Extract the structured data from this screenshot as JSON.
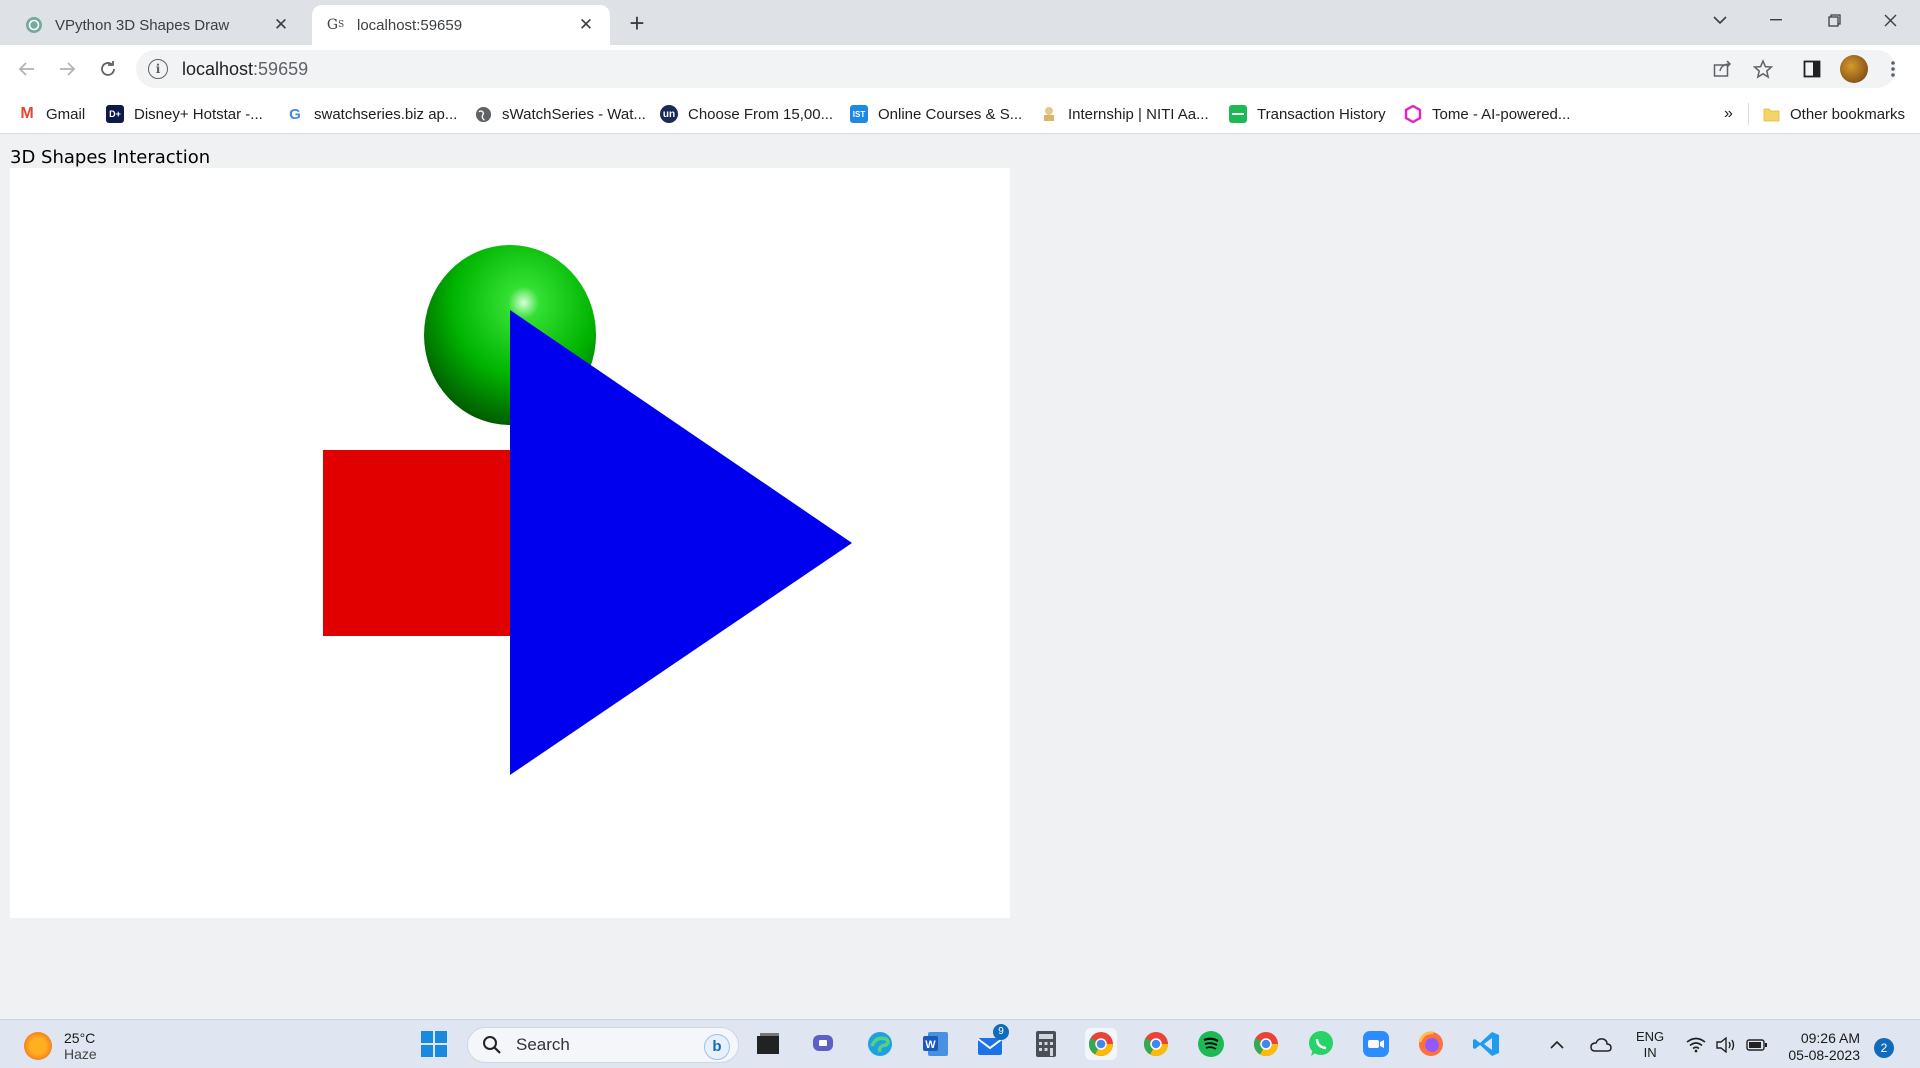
{
  "browser": {
    "tabs": [
      {
        "title": "VPython 3D Shapes Draw",
        "favicon": "chatgpt-icon",
        "active": false
      },
      {
        "title": "localhost:59659",
        "favicon": "glowscript-icon",
        "active": true
      }
    ],
    "new_tab_label": "+",
    "address": {
      "host": "localhost",
      "port": ":59659"
    },
    "bookmarks": [
      {
        "label": "Gmail",
        "icon": "gmail-icon",
        "color": "#ea4335"
      },
      {
        "label": "Disney+ Hotstar -...",
        "icon": "hotstar-icon",
        "color": "#0c1a4b"
      },
      {
        "label": "swatchseries.biz ap...",
        "icon": "google-icon",
        "color": "#4285f4"
      },
      {
        "label": "sWatchSeries - Wat...",
        "icon": "globe-icon",
        "color": "#5f6368"
      },
      {
        "label": "Choose From 15,00...",
        "icon": "unacademy-icon",
        "color": "#1a2b5a"
      },
      {
        "label": "Online Courses & S...",
        "icon": "ist-icon",
        "color": "#1e88e5"
      },
      {
        "label": "Internship | NITI Aa...",
        "icon": "emblem-icon",
        "color": "#c9a14a"
      },
      {
        "label": "Transaction History",
        "icon": "sheet-icon",
        "color": "#1db954"
      },
      {
        "label": "Tome - AI-powered...",
        "icon": "tome-icon",
        "color": "#e91ec5"
      }
    ],
    "more_bookmarks": "»",
    "other_bookmarks": "Other bookmarks"
  },
  "page": {
    "title": "3D Shapes Interaction",
    "scene": {
      "sphere_color": "#00c000",
      "box_color": "#e00000",
      "pyramid_color": "#0000ee"
    }
  },
  "taskbar": {
    "weather": {
      "temp": "25°C",
      "condition": "Haze"
    },
    "search_placeholder": "Search",
    "mail_badge": "9",
    "tray": {
      "lang1": "ENG",
      "lang2": "IN"
    },
    "clock": {
      "time": "09:26 AM",
      "date": "05-08-2023"
    },
    "notifications": "2"
  }
}
